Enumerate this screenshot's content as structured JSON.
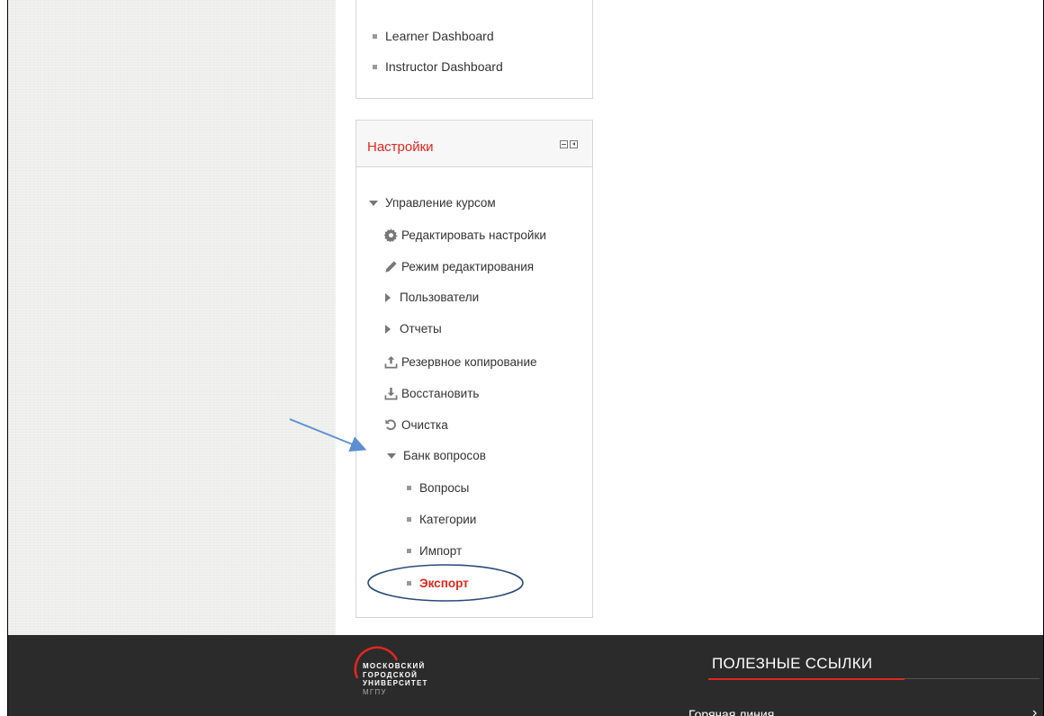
{
  "nav_block": {
    "items": [
      "Learner Dashboard",
      "Instructor Dashboard"
    ]
  },
  "settings": {
    "title": "Настройки",
    "course_admin": {
      "label": "Управление курсом",
      "edit_settings": "Редактировать настройки",
      "edit_mode": "Режим редактирования",
      "users": "Пользователи",
      "reports": "Отчеты",
      "backup": "Резервное копирование",
      "restore": "Восстановить",
      "reset": "Очистка",
      "question_bank": {
        "label": "Банк вопросов",
        "questions": "Вопросы",
        "categories": "Категории",
        "import": "Импорт",
        "export": "Экспорт"
      }
    }
  },
  "footer": {
    "logo_lines": [
      "МОСКОВСКИЙ",
      "ГОРОДСКОЙ",
      "УНИВЕРСИТЕТ"
    ],
    "logo_abbr": "МГПУ",
    "links_title": "ПОЛЕЗНЫЕ ССЫЛКИ",
    "link_hotline": "Горячая линия"
  },
  "colors": {
    "accent": "#e1271e",
    "footer_bg": "#2b2b2b",
    "annotation": "#5b8fd0"
  }
}
